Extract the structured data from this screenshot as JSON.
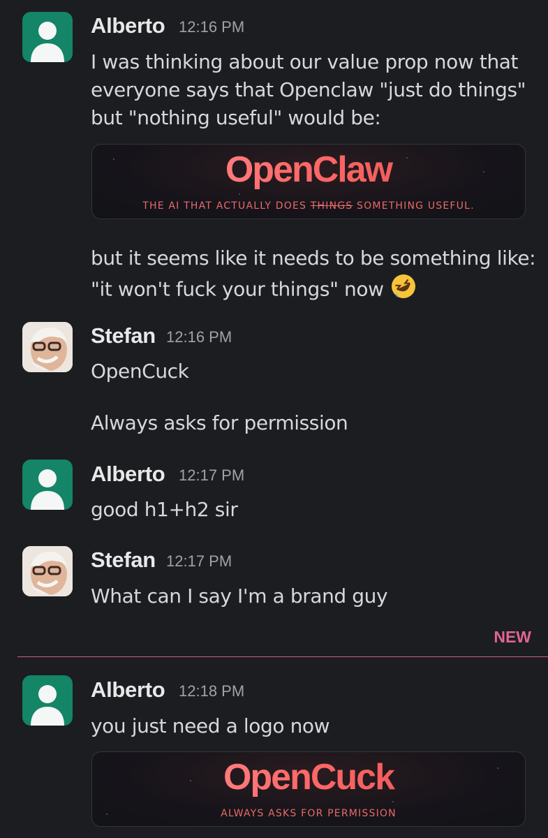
{
  "messages": [
    {
      "author": "Alberto",
      "time": "12:16 PM",
      "text": "I was thinking about our value prop now that everyone says that Openclaw \"just do things\" but \"nothing useful\" would be:",
      "banner": {
        "logo": "OpenClaw",
        "tagline_prefix": "THE AI THAT ACTUALLY DOES ",
        "tagline_struck": "THINGS",
        "tagline_suffix": " SOMETHING USEFUL."
      },
      "followup": "but it seems like it needs to be something like: \"it won't fuck your things\" now",
      "emoji": "rolling-on-floor-laughing"
    },
    {
      "author": "Stefan",
      "time": "12:16 PM",
      "lines": [
        "OpenCuck",
        "Always asks for permission"
      ]
    },
    {
      "author": "Alberto",
      "time": "12:17 PM",
      "text": "good h1+h2 sir"
    },
    {
      "author": "Stefan",
      "time": "12:17 PM",
      "text": "What can I say I'm a brand guy"
    },
    {
      "author": "Alberto",
      "time": "12:18 PM",
      "text": "you just need a logo now",
      "banner": {
        "logo": "OpenCuck",
        "tagline": "ALWAYS ASKS FOR PERMISSION"
      }
    }
  ],
  "divider": {
    "label": "NEW"
  },
  "colors": {
    "avatar_default": "#148567",
    "new_accent": "#d35a86",
    "logo_red": "#ff6b6b"
  }
}
